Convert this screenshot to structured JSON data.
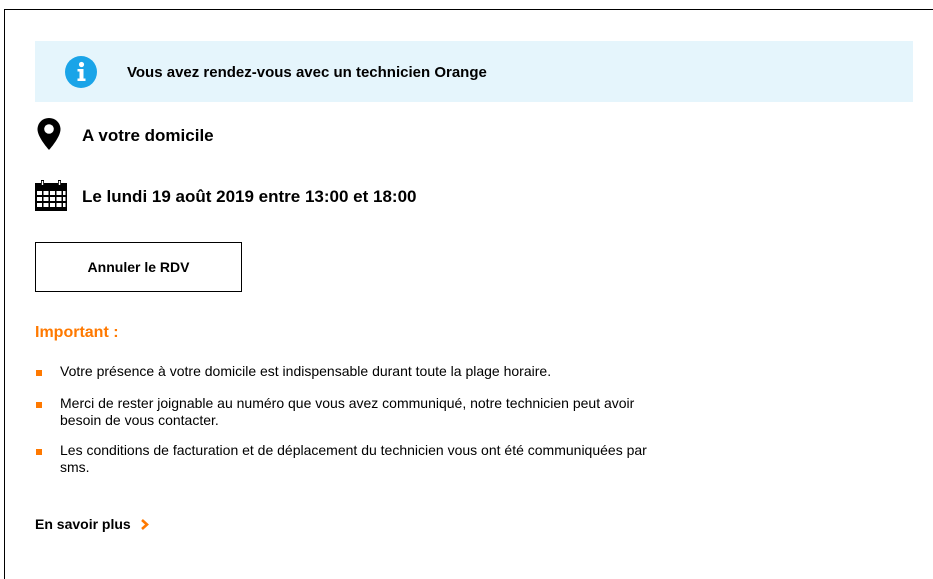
{
  "banner": {
    "icon": "info-icon",
    "text": "Vous avez rendez-vous avec un technicien Orange",
    "icon_color": "#1aa4e8",
    "background": "#e5f5fc"
  },
  "location": {
    "icon": "map-pin-icon",
    "text": "A votre domicile"
  },
  "appointment": {
    "icon": "calendar-icon",
    "text": "Le lundi 19 août 2019 entre 13:00 et 18:00"
  },
  "actions": {
    "cancel_label": "Annuler le RDV"
  },
  "important": {
    "title": "Important :",
    "color": "#ff7900",
    "items": [
      "Votre présence à votre domicile est indispensable durant toute la plage horaire.",
      "Merci de rester joignable au numéro que vous avez communiqué, notre technicien peut avoir besoin de vous contacter.",
      "Les conditions de facturation et de déplacement du technicien vous ont été communiquées par sms."
    ]
  },
  "learn_more": {
    "label": "En savoir plus",
    "icon": "chevron-right-icon"
  }
}
